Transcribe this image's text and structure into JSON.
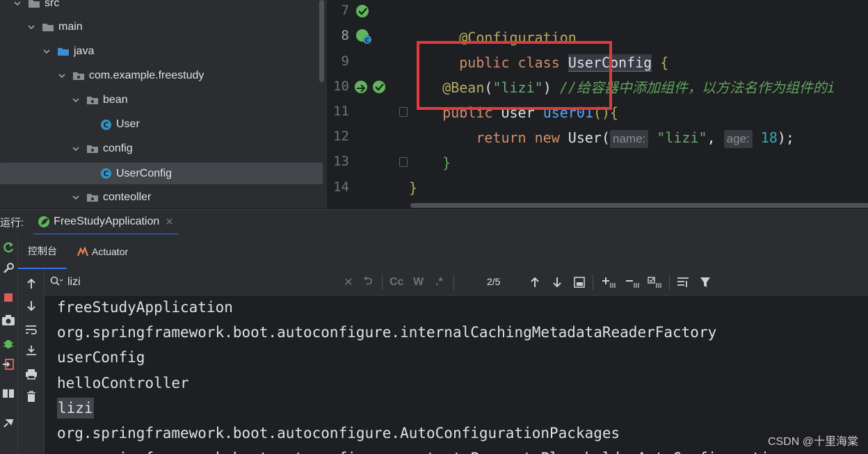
{
  "project_tree": {
    "items": [
      {
        "label": "src",
        "type": "folder",
        "expanded": true
      },
      {
        "label": "main",
        "type": "folder",
        "expanded": true
      },
      {
        "label": "java",
        "type": "source-folder",
        "expanded": true
      },
      {
        "label": "com.example.freestudy",
        "type": "package",
        "expanded": true
      },
      {
        "label": "bean",
        "type": "package",
        "expanded": true
      },
      {
        "label": "User",
        "type": "class"
      },
      {
        "label": "config",
        "type": "package",
        "expanded": true
      },
      {
        "label": "UserConfig",
        "type": "class",
        "selected": true
      },
      {
        "label": "conteoller",
        "type": "package",
        "expanded": true
      }
    ]
  },
  "editor": {
    "line_numbers": [
      "7",
      "8",
      "9",
      "10",
      "11",
      "12",
      "13",
      "14"
    ],
    "lines": {
      "l7": {
        "annotation": "@Configuration"
      },
      "l8": {
        "kw1": "public",
        "kw2": "class",
        "name": "UserConfig",
        "brace": "{"
      },
      "l10": {
        "annotation": "@Bean",
        "open": "(",
        "arg": "\"lizi\"",
        "close": ")",
        "comment": "//给容器中添加组件，以方法名作为组件的i"
      },
      "l11": {
        "kw1": "public",
        "type": "User",
        "method": "user01",
        "rest": "(){"
      },
      "l12": {
        "kw1": "return",
        "kw2": "new",
        "type": "User",
        "open": "(",
        "hint1": "name:",
        "arg1": "\"lizi\"",
        "comma": ",",
        "hint2": "age:",
        "arg2": "18",
        "close": ");"
      },
      "l13": {
        "brace": "}"
      },
      "l14": {
        "brace": "}"
      }
    }
  },
  "run_window": {
    "label": "运行:",
    "tab": "FreeStudyApplication",
    "subtabs": [
      "控制台",
      "Actuator"
    ],
    "search": {
      "value": "lizi",
      "match_count": "2/5",
      "case_label": "Cc",
      "word_label": "W",
      "regex_label": ".*"
    },
    "console_lines": [
      "freeStudyApplication",
      "org.springframework.boot.autoconfigure.internalCachingMetadataReaderFactory",
      "userConfig",
      "helloController",
      "lizi",
      "org.springframework.boot.autoconfigure.AutoConfigurationPackages",
      "org.springframework.boot.autoconfigure.context.PropertyPlaceholderAutoConfiguration"
    ]
  },
  "watermark": "CSDN @十里海棠",
  "colors": {
    "accent": "#3574f0",
    "highlight_box": "#e23a3a",
    "keyword": "#cf8e6d",
    "string": "#6aab73",
    "annotation": "#b3ae60"
  }
}
